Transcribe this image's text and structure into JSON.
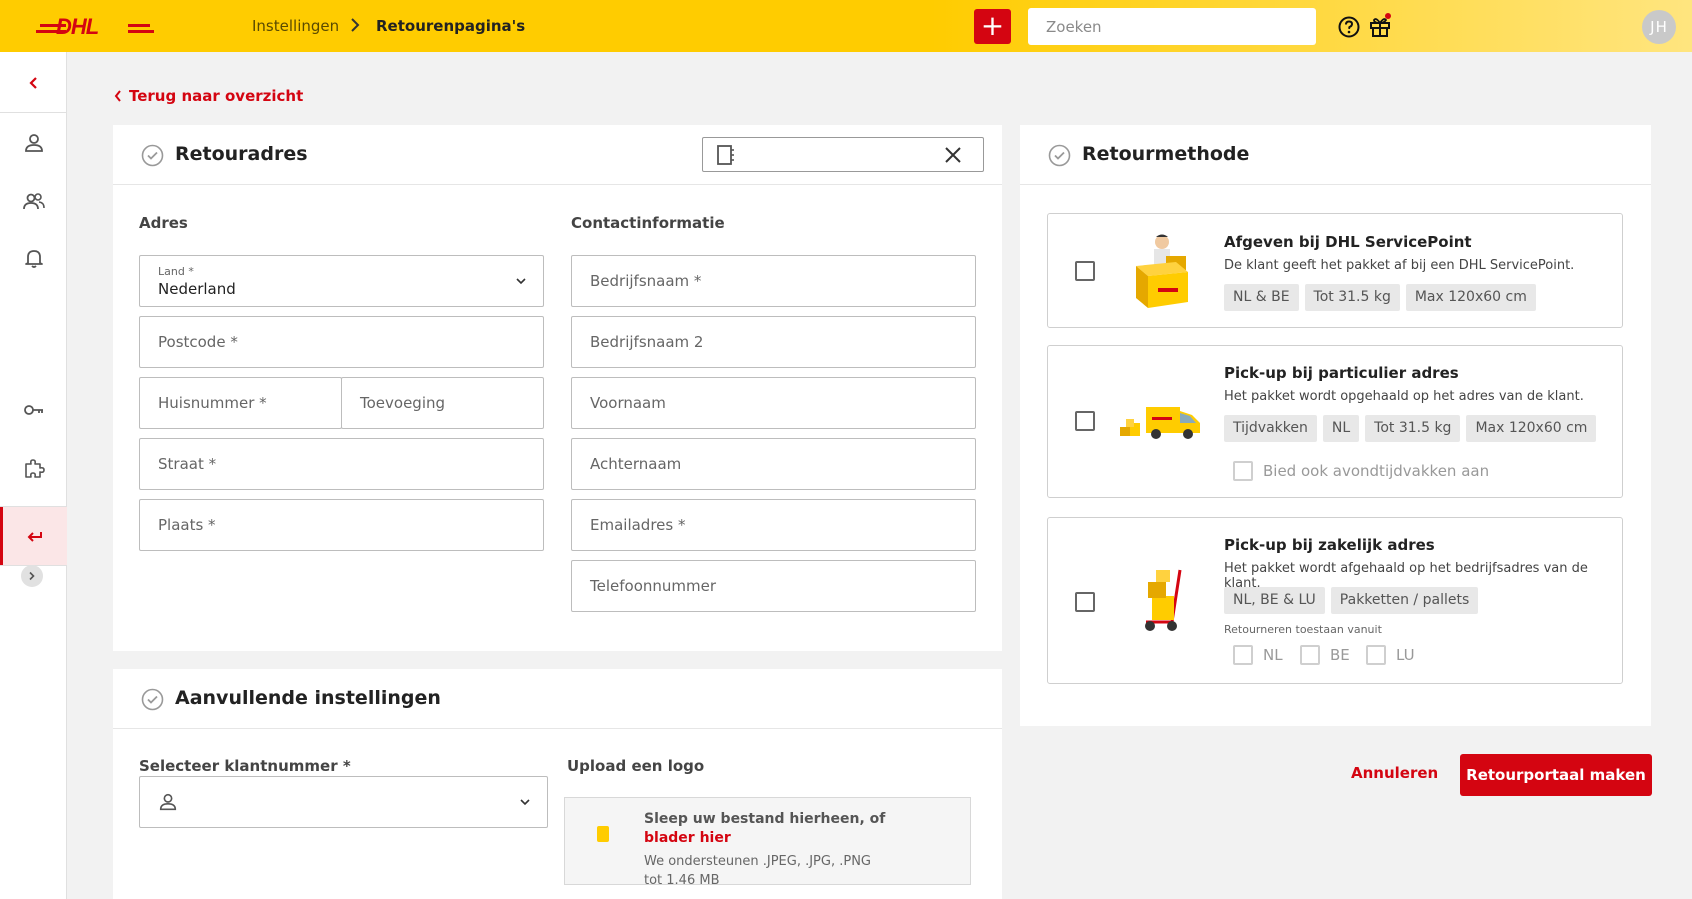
{
  "header": {
    "logo_text": "DHL",
    "breadcrumb": [
      "Instellingen",
      "Retourenpagina's"
    ],
    "add_label": "+",
    "search_placeholder": "Zoeken",
    "user_initials": "JH"
  },
  "nav": {
    "back_label": "Terug naar overzicht"
  },
  "address": {
    "title": "Retouradres",
    "section_address": "Adres",
    "section_contact": "Contactinformatie",
    "country_label": "Land *",
    "country_value": "Nederland",
    "postcode": "Postcode *",
    "housenumber": "Huisnummer *",
    "addition": "Toevoeging",
    "street": "Straat *",
    "city": "Plaats *",
    "company": "Bedrijfsnaam *",
    "company2": "Bedrijfsnaam 2",
    "firstname": "Voornaam",
    "lastname": "Achternaam",
    "email": "Emailadres *",
    "phone": "Telefoonnummer"
  },
  "additional": {
    "title": "Aanvullende instellingen",
    "customer_label": "Selecteer klantnummer *",
    "upload_label": "Upload een logo",
    "upload_title": "Sleep uw bestand hierheen, of",
    "upload_link": "blader hier",
    "upload_formats": "We ondersteunen .JPEG, .JPG, .PNG",
    "upload_size": "tot 1.46 MB"
  },
  "return_method": {
    "title": "Retourmethode",
    "methods": [
      {
        "title": "Afgeven bij DHL ServicePoint",
        "desc": "De klant geeft het pakket af bij een DHL ServicePoint.",
        "tags": [
          "NL & BE",
          "Tot 31.5 kg",
          "Max 120x60 cm"
        ]
      },
      {
        "title": "Pick-up bij particulier adres",
        "desc": "Het pakket wordt opgehaald op het adres van de klant.",
        "tags": [
          "Tijdvakken",
          "NL",
          "Tot 31.5 kg",
          "Max 120x60 cm"
        ],
        "option": "Bied ook avondtijdvakken aan"
      },
      {
        "title": "Pick-up bij zakelijk adres",
        "desc": "Het pakket wordt afgehaald op het bedrijfsadres van de klant.",
        "tags": [
          "NL, BE & LU",
          "Pakketten / pallets"
        ],
        "countries_label": "Retourneren toestaan vanuit",
        "countries": [
          "NL",
          "BE",
          "LU"
        ]
      }
    ]
  },
  "actions": {
    "cancel": "Annuleren",
    "submit": "Retourportaal maken"
  },
  "colors": {
    "brand_yellow": "#ffcc00",
    "brand_red": "#d40511"
  }
}
